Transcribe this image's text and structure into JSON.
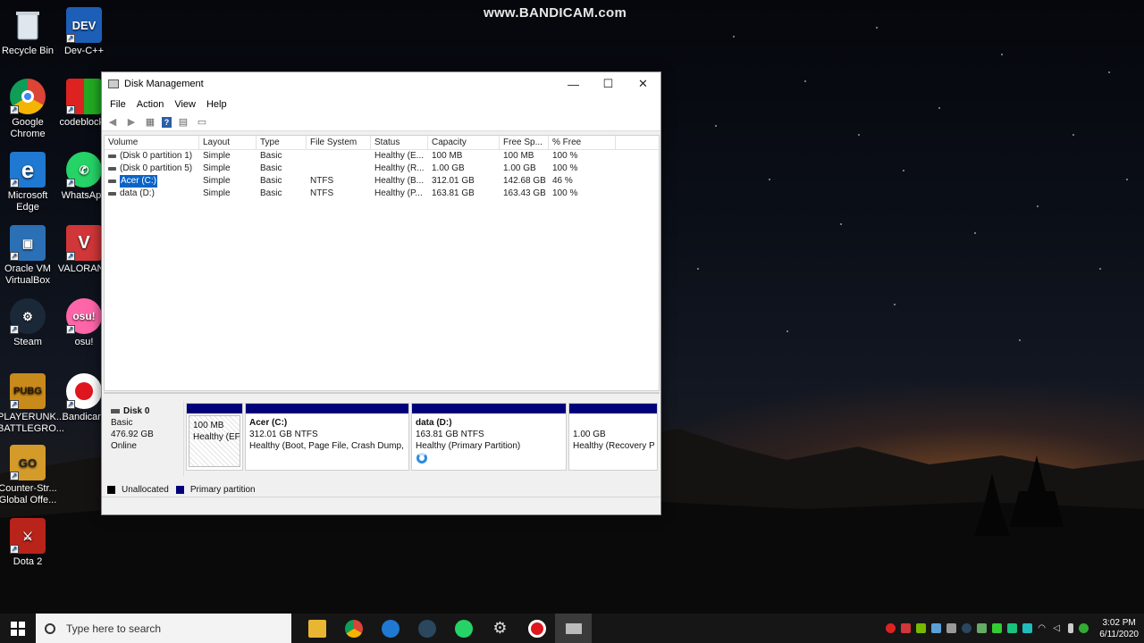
{
  "watermark": "www.BANDICAM.com",
  "desktop": {
    "icons": [
      {
        "label": "Recycle Bin",
        "icon": "recycle-bin-icon"
      },
      {
        "label": "Dev-C++",
        "icon": "devcpp-icon",
        "badge": "DEV"
      },
      {
        "label": "Google Chrome",
        "icon": "chrome-icon"
      },
      {
        "label": "codeblocks",
        "icon": "codeblocks-icon"
      },
      {
        "label": "Microsoft Edge",
        "icon": "edge-icon",
        "badge": "e"
      },
      {
        "label": "WhatsApp",
        "icon": "whatsapp-icon"
      },
      {
        "label": "Oracle VM VirtualBox",
        "icon": "virtualbox-icon"
      },
      {
        "label": "VALORANT",
        "icon": "valorant-icon"
      },
      {
        "label": "Steam",
        "icon": "steam-icon"
      },
      {
        "label": "osu!",
        "icon": "osu-icon",
        "badge": "osu!"
      },
      {
        "label": "PLAYERUNK... BATTLEGRO...",
        "icon": "pubg-icon",
        "badge": "PUBG"
      },
      {
        "label": "Bandicam",
        "icon": "bandicam-icon"
      },
      {
        "label": "Counter-Str... Global Offe...",
        "icon": "csgo-icon",
        "badge": "GO"
      },
      {
        "label": "Dota 2",
        "icon": "dota2-icon"
      }
    ]
  },
  "window": {
    "title": "Disk Management",
    "menu": [
      "File",
      "Action",
      "View",
      "Help"
    ],
    "columns": [
      "Volume",
      "Layout",
      "Type",
      "File System",
      "Status",
      "Capacity",
      "Free Sp...",
      "% Free"
    ],
    "rows": [
      {
        "volume": "(Disk 0 partition 1)",
        "layout": "Simple",
        "type": "Basic",
        "fs": "",
        "status": "Healthy (E...",
        "capacity": "100 MB",
        "free": "100 MB",
        "pct": "100 %",
        "selected": false
      },
      {
        "volume": "(Disk 0 partition 5)",
        "layout": "Simple",
        "type": "Basic",
        "fs": "",
        "status": "Healthy (R...",
        "capacity": "1.00 GB",
        "free": "1.00 GB",
        "pct": "100 %",
        "selected": false
      },
      {
        "volume": "Acer (C:)",
        "layout": "Simple",
        "type": "Basic",
        "fs": "NTFS",
        "status": "Healthy (B...",
        "capacity": "312.01 GB",
        "free": "142.68 GB",
        "pct": "46 %",
        "selected": true
      },
      {
        "volume": "data (D:)",
        "layout": "Simple",
        "type": "Basic",
        "fs": "NTFS",
        "status": "Healthy (P...",
        "capacity": "163.81 GB",
        "free": "163.43 GB",
        "pct": "100 %",
        "selected": false
      }
    ],
    "disk": {
      "name": "Disk 0",
      "type": "Basic",
      "size": "476.92 GB",
      "state": "Online",
      "partitions": [
        {
          "name": "",
          "size": "100 MB",
          "status": "Healthy (EFI",
          "hatched": true
        },
        {
          "name": "Acer  (C:)",
          "size": "312.01 GB NTFS",
          "status": "Healthy (Boot, Page File, Crash Dump,",
          "hatched": false
        },
        {
          "name": "data  (D:)",
          "size": "163.81 GB NTFS",
          "status": "Healthy (Primary Partition)",
          "hatched": false
        },
        {
          "name": "",
          "size": "1.00 GB",
          "status": "Healthy (Recovery P",
          "hatched": false
        }
      ]
    },
    "legend": [
      {
        "label": "Unallocated",
        "color": "#000000"
      },
      {
        "label": "Primary partition",
        "color": "#00007a"
      }
    ]
  },
  "taskbar": {
    "search_placeholder": "Type here to search",
    "time": "3:02 PM",
    "date": "6/11/2020"
  }
}
